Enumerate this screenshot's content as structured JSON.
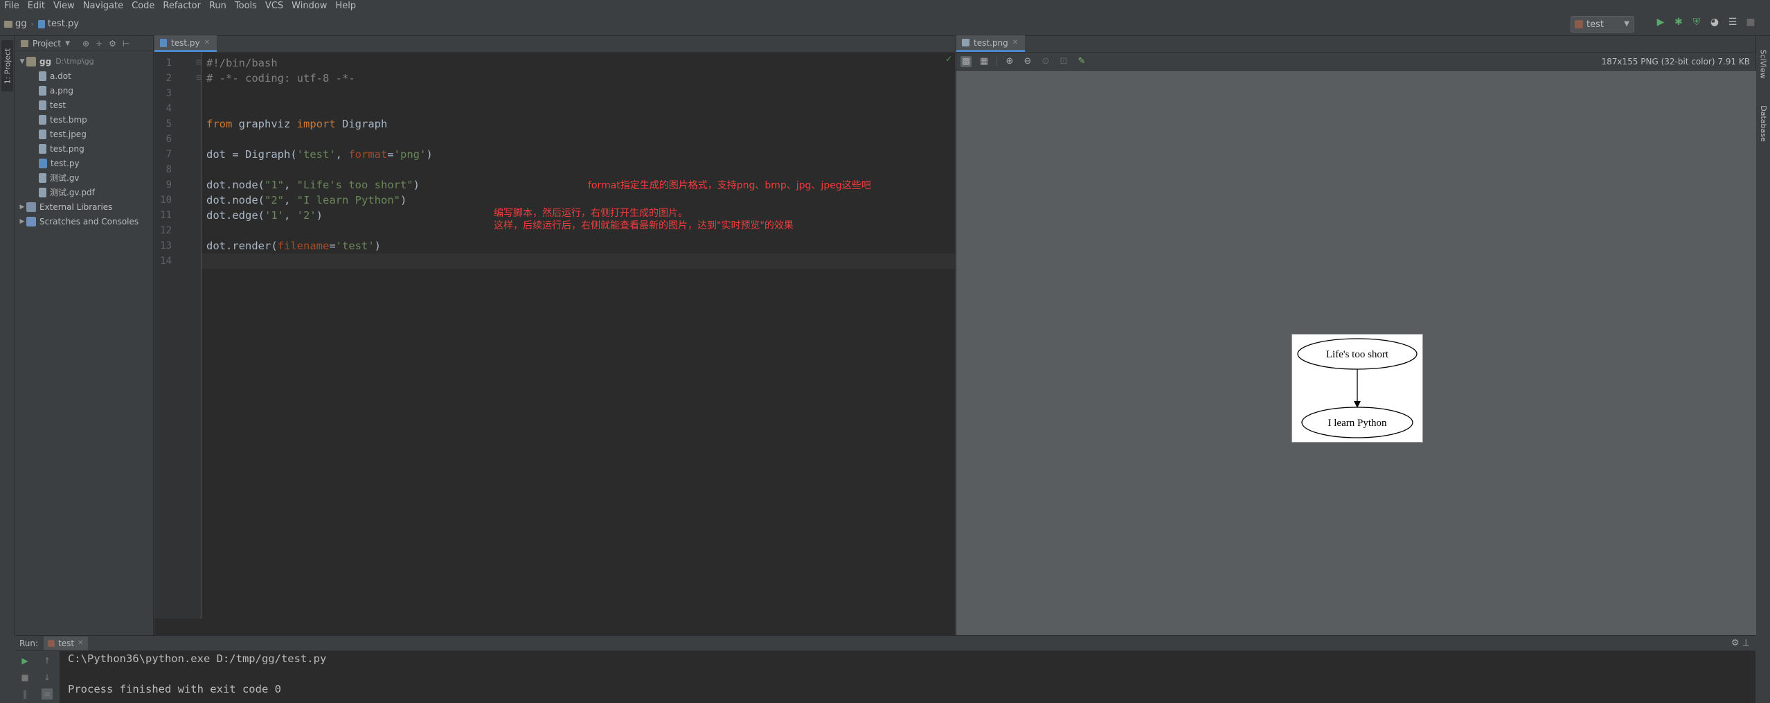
{
  "menu": [
    "File",
    "Edit",
    "View",
    "Navigate",
    "Code",
    "Refactor",
    "Run",
    "Tools",
    "VCS",
    "Window",
    "Help"
  ],
  "breadcrumb": {
    "project": "gg",
    "file": "test.py"
  },
  "run_config": "test",
  "left_stripe_tab": "1: Project",
  "right_stripe_tabs": [
    "SciView",
    "Database"
  ],
  "project_panel": {
    "title": "Project",
    "tree": [
      {
        "label": "gg",
        "sub": "D:\\tmp\\gg",
        "type": "folder",
        "level": 0,
        "expanded": true
      },
      {
        "label": "a.dot",
        "type": "file",
        "level": 1
      },
      {
        "label": "a.png",
        "type": "file",
        "level": 1
      },
      {
        "label": "test",
        "type": "file",
        "level": 1
      },
      {
        "label": "test.bmp",
        "type": "file",
        "level": 1
      },
      {
        "label": "test.jpeg",
        "type": "file",
        "level": 1
      },
      {
        "label": "test.png",
        "type": "file",
        "level": 1
      },
      {
        "label": "test.py",
        "type": "py",
        "level": 1
      },
      {
        "label": "测试.gv",
        "type": "file",
        "level": 1
      },
      {
        "label": "测试.gv.pdf",
        "type": "file",
        "level": 1
      },
      {
        "label": "External Libraries",
        "type": "lib",
        "level": 0,
        "expanded": false
      },
      {
        "label": "Scratches and Consoles",
        "type": "scratch",
        "level": 0,
        "expanded": false
      }
    ]
  },
  "editor": {
    "tab": "test.py",
    "line_numbers": [
      "1",
      "2",
      "3",
      "4",
      "5",
      "6",
      "7",
      "8",
      "9",
      "10",
      "11",
      "12",
      "13",
      "14"
    ],
    "current_line": 14,
    "lines": [
      [
        {
          "t": "#!/bin/bash",
          "c": "cmt"
        }
      ],
      [
        {
          "t": "# -*- coding: utf-8 -*-",
          "c": "cmt"
        }
      ],
      [],
      [],
      [
        {
          "t": "from",
          "c": "kw"
        },
        {
          "t": " graphviz ",
          "c": ""
        },
        {
          "t": "import",
          "c": "kw"
        },
        {
          "t": " Digraph",
          "c": ""
        }
      ],
      [],
      [
        {
          "t": "dot = Digraph(",
          "c": ""
        },
        {
          "t": "'test'",
          "c": "str"
        },
        {
          "t": ", ",
          "c": ""
        },
        {
          "t": "format",
          "c": "param"
        },
        {
          "t": "=",
          "c": ""
        },
        {
          "t": "'png'",
          "c": "str"
        },
        {
          "t": ")",
          "c": ""
        }
      ],
      [],
      [
        {
          "t": "dot.node(",
          "c": ""
        },
        {
          "t": "\"1\"",
          "c": "str"
        },
        {
          "t": ", ",
          "c": ""
        },
        {
          "t": "\"Life's too short\"",
          "c": "str"
        },
        {
          "t": ")",
          "c": ""
        }
      ],
      [
        {
          "t": "dot.node(",
          "c": ""
        },
        {
          "t": "\"2\"",
          "c": "str"
        },
        {
          "t": ", ",
          "c": ""
        },
        {
          "t": "\"I learn Python\"",
          "c": "str"
        },
        {
          "t": ")",
          "c": ""
        }
      ],
      [
        {
          "t": "dot.edge(",
          "c": ""
        },
        {
          "t": "'1'",
          "c": "str"
        },
        {
          "t": ", ",
          "c": ""
        },
        {
          "t": "'2'",
          "c": "str"
        },
        {
          "t": ")",
          "c": ""
        }
      ],
      [],
      [
        {
          "t": "dot.render(",
          "c": ""
        },
        {
          "t": "filename",
          "c": "param"
        },
        {
          "t": "=",
          "c": ""
        },
        {
          "t": "'test'",
          "c": "str"
        },
        {
          "t": ")",
          "c": ""
        }
      ],
      []
    ],
    "annotations": {
      "line7": "format指定生成的图片格式，支持png、bmp、jpg、jpeg这些吧",
      "note1": "编写脚本，然后运行，右侧打开生成的图片。",
      "note2": "这样，后续运行后，右侧就能查看最新的图片，达到\"实时预览\"的效果"
    }
  },
  "viewer": {
    "tab": "test.png",
    "image_info": "187x155 PNG (32-bit color) 7.91 KB",
    "graph": {
      "node1": "Life's too short",
      "node2": "I learn Python"
    }
  },
  "run_panel": {
    "label": "Run:",
    "tab": "test",
    "console": [
      "C:\\Python36\\python.exe D:/tmp/gg/test.py",
      "",
      "Process finished with exit code 0"
    ]
  },
  "colors": {
    "keyword": "#cc7832",
    "string": "#6a8759",
    "comment": "#808080",
    "param": "#aa4926",
    "annotation": "#ec3e3e",
    "accent": "#4a88c7"
  }
}
